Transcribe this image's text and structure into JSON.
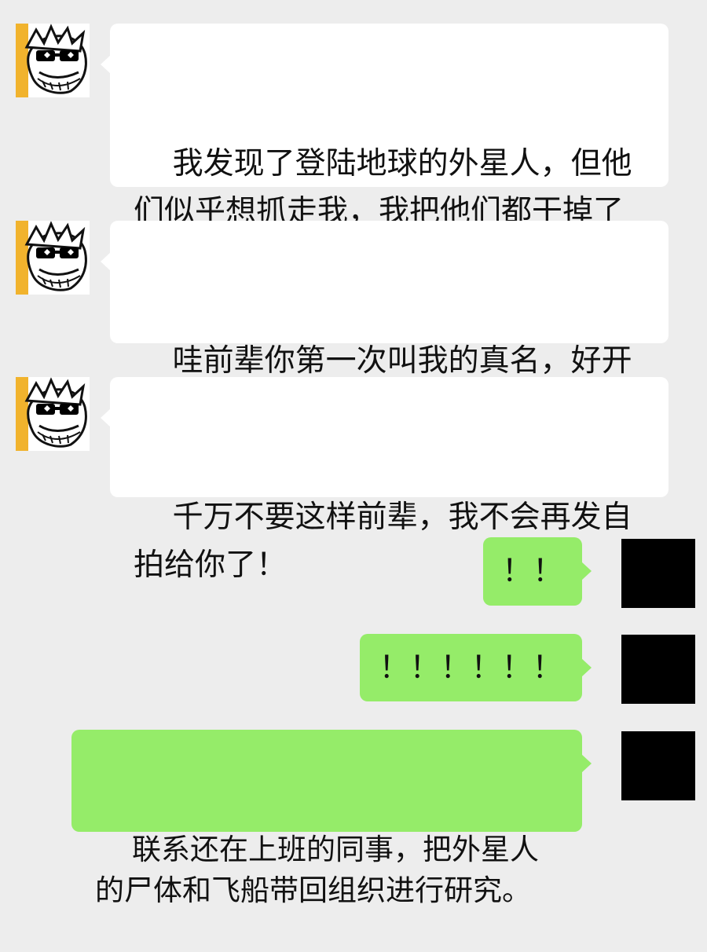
{
  "chat": {
    "messages": [
      {
        "text": "我发现了登陆地球的外星人，但他们似乎想抓走我，我把他们都干掉了"
      },
      {
        "text": "哇前辈你第一次叫我的真名，好开心"
      },
      {
        "text": "千万不要这样前辈，我不会再发自拍给你了！"
      },
      {
        "text": "！！"
      },
      {
        "text": "！！！！！！"
      },
      {
        "text": "联系还在上班的同事，把外星人的尸体和飞船带回组织进行研究。"
      }
    ]
  },
  "icons": {
    "contact_avatar": "cartoon-face-with-sunglasses-avatar",
    "self_avatar": "black-avatar"
  },
  "colors": {
    "background": "#ededed",
    "incoming_bubble": "#ffffff",
    "outgoing_bubble": "#95ec69",
    "contact_avatar_accent": "#f1b32d",
    "self_avatar": "#000000"
  }
}
